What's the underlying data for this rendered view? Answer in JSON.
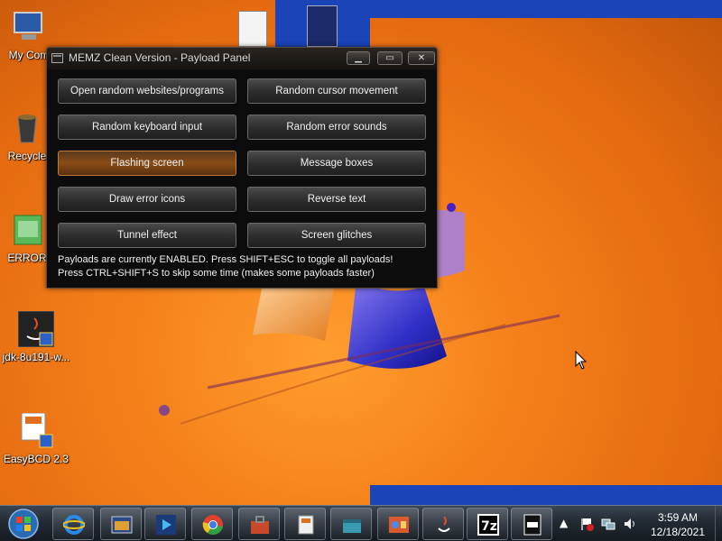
{
  "window": {
    "title": "MEMZ Clean Version - Payload Panel",
    "minimize_icon": "minimize-icon",
    "maximize_icon": "maximize-icon",
    "close_icon": "close-icon"
  },
  "payloads": [
    {
      "label": "Open random websites/programs",
      "active": false
    },
    {
      "label": "Random cursor movement",
      "active": false
    },
    {
      "label": "Random keyboard input",
      "active": false
    },
    {
      "label": "Random error sounds",
      "active": false
    },
    {
      "label": "Flashing screen",
      "active": true
    },
    {
      "label": "Message boxes",
      "active": false
    },
    {
      "label": "Draw error icons",
      "active": false
    },
    {
      "label": "Reverse text",
      "active": false
    },
    {
      "label": "Tunnel effect",
      "active": false
    },
    {
      "label": "Screen glitches",
      "active": false
    }
  ],
  "status": {
    "line1": "Payloads are currently ENABLED. Press SHIFT+ESC to toggle all payloads!",
    "line2": "Press CTRL+SHIFT+S to skip some time (makes some payloads faster)"
  },
  "desktop_icons": [
    {
      "label": "My Com",
      "icon": "computer-icon"
    },
    {
      "label": "Recycle",
      "icon": "recycle-bin-icon"
    },
    {
      "label": "ERROR",
      "icon": "error-file-icon"
    },
    {
      "label": "jdk-8u191-w...",
      "icon": "java-installer-icon"
    },
    {
      "label": "EasyBCD 2.3",
      "icon": "easybcd-icon"
    }
  ],
  "taskbar": {
    "items": [
      {
        "icon": "internet-explorer-icon"
      },
      {
        "icon": "file-explorer-icon"
      },
      {
        "icon": "media-player-icon"
      },
      {
        "icon": "chrome-icon"
      },
      {
        "icon": "toolbox-icon"
      },
      {
        "icon": "installer-icon"
      },
      {
        "icon": "toolbox-2-icon"
      },
      {
        "icon": "control-panel-icon"
      },
      {
        "icon": "java-icon"
      },
      {
        "icon": "7zip-icon"
      },
      {
        "icon": "system-file-icon"
      }
    ],
    "clock_time": "3:59 AM",
    "clock_date": "12/18/2021"
  },
  "colors": {
    "wallpaper": "#f07a18",
    "panel_bg": "#0c0c0c",
    "active_button": "#8a4c16"
  }
}
